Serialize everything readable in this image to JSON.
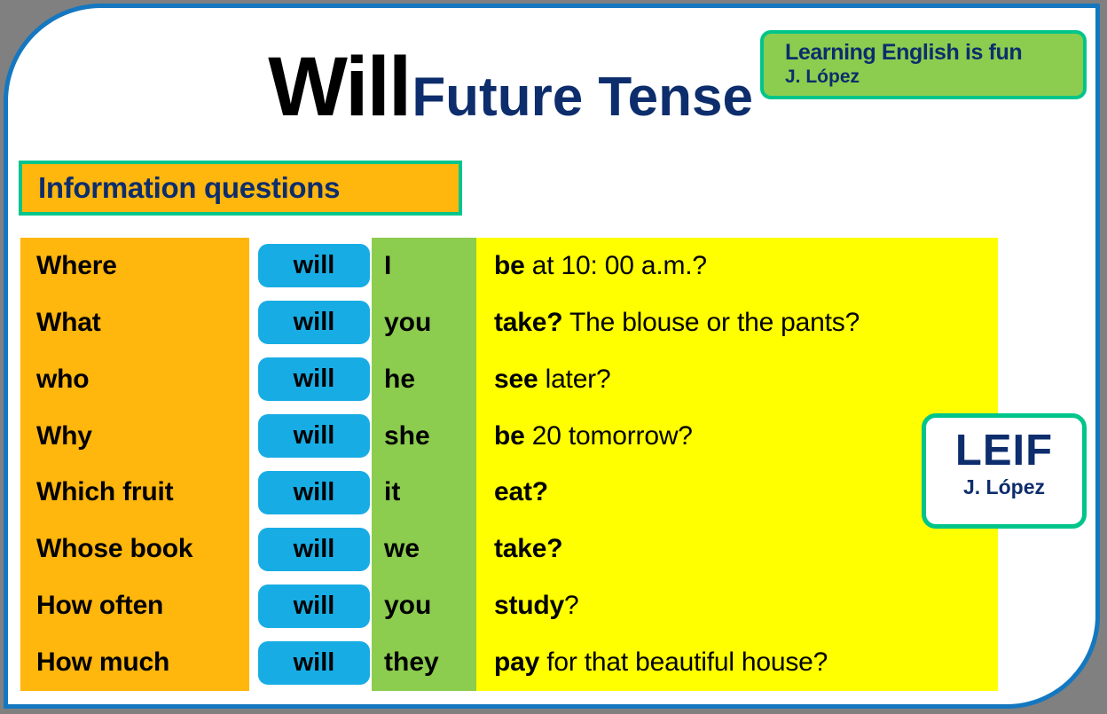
{
  "poster": {
    "title_primary": "Will",
    "title_secondary": "Future Tense",
    "section_label": "Information questions"
  },
  "brand_badge": {
    "line1": "Learning English is fun",
    "line2": "J. López"
  },
  "leif_badge": {
    "title": "LEIF",
    "subtitle": "J. López"
  },
  "colors": {
    "frame_border": "#1477c0",
    "page_background": "#808080",
    "amber": "#ffb60d",
    "teal_border": "#00c58b",
    "green": "#8ccc4e",
    "yellow": "#ffff00",
    "chip_blue": "#18ace4",
    "navy_text": "#0d2d6c"
  },
  "table": {
    "rows": [
      {
        "question_word": "Where",
        "auxiliary": "will",
        "pronoun": "I",
        "verb": "be",
        "complement": " at 10: 00 a.m.?"
      },
      {
        "question_word": "What",
        "auxiliary": "will",
        "pronoun": "you",
        "verb": "take?",
        "complement": " The blouse or the pants?"
      },
      {
        "question_word": "who",
        "auxiliary": "will",
        "pronoun": "he",
        "verb": "see",
        "complement": "  later?"
      },
      {
        "question_word": "Why",
        "auxiliary": "will",
        "pronoun": "she",
        "verb": "be",
        "complement": " 20 tomorrow?"
      },
      {
        "question_word": "Which fruit",
        "auxiliary": "will",
        "pronoun": "it",
        "verb": "eat?",
        "complement": ""
      },
      {
        "question_word": "Whose book",
        "auxiliary": "will",
        "pronoun": "we",
        "verb": "take?",
        "complement": ""
      },
      {
        "question_word": "How often",
        "auxiliary": "will",
        "pronoun": "you",
        "verb": "study",
        "complement": "?"
      },
      {
        "question_word": "How much",
        "auxiliary": "will",
        "pronoun": "they",
        "verb": "pay",
        "complement": " for that beautiful house?"
      }
    ]
  }
}
